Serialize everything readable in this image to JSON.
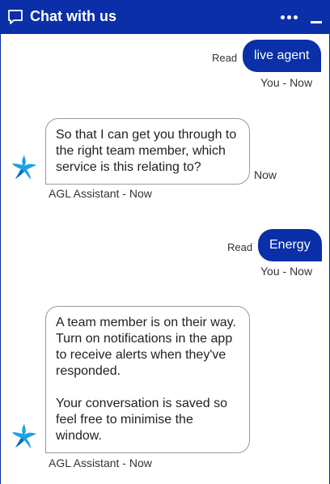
{
  "header": {
    "title": "Chat with us",
    "chat_icon": "chat-bubble-icon",
    "more_icon": "more-dots-icon",
    "minimise_icon": "minimise-icon",
    "background": "#0a2fa8"
  },
  "messages": {
    "m1": {
      "read": "Read",
      "text": "live agent",
      "meta": "You - Now"
    },
    "m2": {
      "text": "So that I can get you through to the right team member, which service is this relating to?",
      "side_time": "Now",
      "meta": "AGL Assistant - Now",
      "avatar_icon": "agl-star-icon"
    },
    "m3": {
      "read": "Read",
      "text": "Energy",
      "meta": "You - Now"
    },
    "m4": {
      "paragraph1": "A team member is on their way. Turn on notifications in the app to receive alerts when they've responded.",
      "paragraph2": "Your conversation is saved so feel free to minimise the window.",
      "meta": "AGL Assistant - Now",
      "avatar_icon": "agl-star-icon"
    }
  },
  "colors": {
    "brand": "#0a2fa8",
    "bubble_border": "#9a9a9a",
    "avatar_star": "#1aa3e0"
  }
}
